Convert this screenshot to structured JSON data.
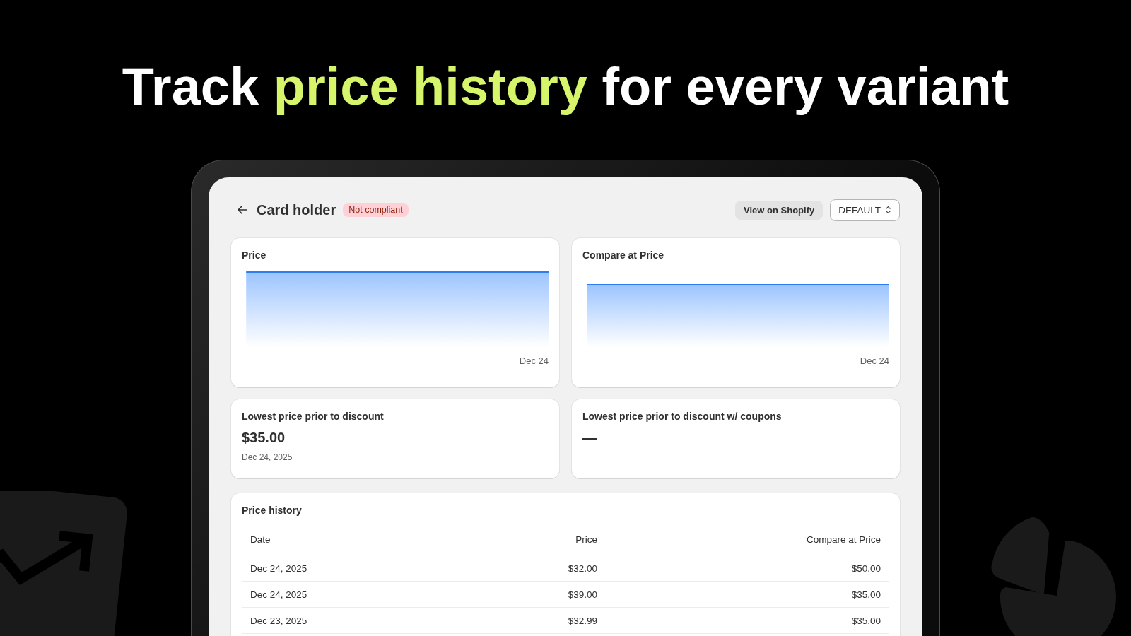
{
  "headline": {
    "parts": [
      {
        "text": "Track",
        "highlighted": false
      },
      {
        "text": "price history",
        "highlighted": true
      },
      {
        "text": "for every variant",
        "highlighted": false
      }
    ]
  },
  "page": {
    "title": "Card holder",
    "badge": {
      "label": "Not compliant"
    },
    "actions": [
      {
        "kind": "button",
        "label": "View on Shopify"
      },
      {
        "kind": "select",
        "label": "DEFAULT"
      }
    ]
  },
  "charts": [
    {
      "title": "Price",
      "x_label": "Dec 24"
    },
    {
      "title": "Compare at Price",
      "x_label": "Dec 24"
    }
  ],
  "stats": [
    {
      "title": "Lowest price prior to discount",
      "value": "$35.00",
      "date": "Dec 24, 2025"
    },
    {
      "title": "Lowest price prior to discount w/ coupons",
      "value": "—"
    }
  ],
  "price_history": {
    "title": "Price history",
    "columns": [
      "Date",
      "Price",
      "Compare at Price"
    ],
    "rows": [
      [
        "Dec 24, 2025",
        "$32.00",
        "$50.00"
      ],
      [
        "Dec 24, 2025",
        "$39.00",
        "$35.00"
      ],
      [
        "Dec 23, 2025",
        "$32.99",
        "$35.00"
      ]
    ]
  }
}
